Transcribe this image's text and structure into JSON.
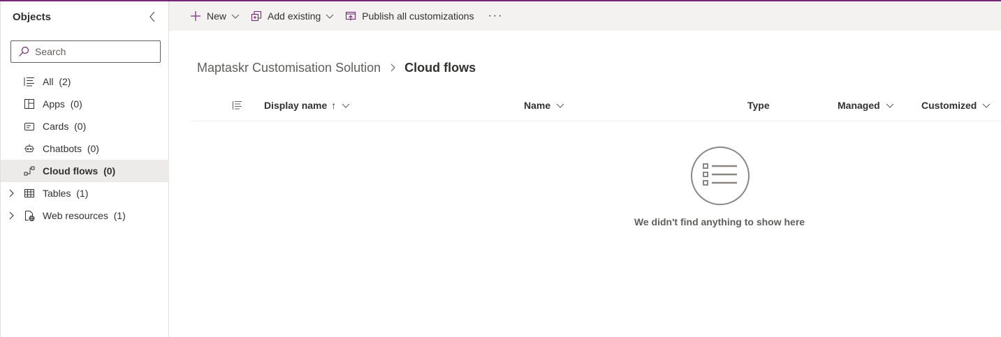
{
  "colors": {
    "accent": "#742774",
    "selected_bg": "#edebe9",
    "commandbar_bg": "#f3f2f1"
  },
  "sidebar": {
    "title": "Objects",
    "search_placeholder": "Search",
    "items": [
      {
        "label": "All",
        "count": "(2)",
        "icon": "list-icon",
        "expandable": false,
        "selected": false
      },
      {
        "label": "Apps",
        "count": "(0)",
        "icon": "apps-icon",
        "expandable": false,
        "selected": false
      },
      {
        "label": "Cards",
        "count": "(0)",
        "icon": "card-icon",
        "expandable": false,
        "selected": false
      },
      {
        "label": "Chatbots",
        "count": "(0)",
        "icon": "bot-icon",
        "expandable": false,
        "selected": false
      },
      {
        "label": "Cloud flows",
        "count": "(0)",
        "icon": "flow-icon",
        "expandable": false,
        "selected": true
      },
      {
        "label": "Tables",
        "count": "(1)",
        "icon": "table-icon",
        "expandable": true,
        "selected": false
      },
      {
        "label": "Web resources",
        "count": "(1)",
        "icon": "web-resource-icon",
        "expandable": true,
        "selected": false
      }
    ]
  },
  "commandbar": {
    "new_label": "New",
    "add_existing_label": "Add existing",
    "publish_label": "Publish all customizations",
    "more_label": "···"
  },
  "breadcrumb": {
    "parent": "Maptaskr Customisation Solution",
    "current": "Cloud flows"
  },
  "table": {
    "columns": {
      "display_name": "Display name",
      "display_name_sort": "↑",
      "name": "Name",
      "type": "Type",
      "managed": "Managed",
      "customized": "Customized"
    }
  },
  "empty_state": {
    "message": "We didn't find anything to show here"
  }
}
